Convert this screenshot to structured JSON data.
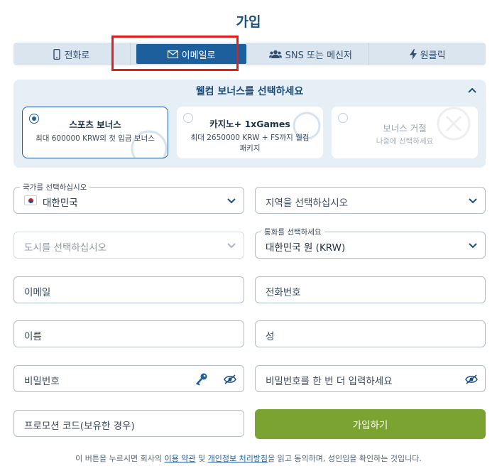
{
  "page": {
    "title": "가입"
  },
  "tabs": [
    {
      "label": "전화로",
      "icon": "phone-icon",
      "active": false
    },
    {
      "label": "이메일로",
      "icon": "mail-icon",
      "active": true
    },
    {
      "label": "SNS 또는 메신저",
      "icon": "users-icon",
      "active": false
    },
    {
      "label": "원클릭",
      "icon": "lightning-icon",
      "active": false
    }
  ],
  "bonus": {
    "heading": "웰컴 보너스를 선택하세요",
    "options": [
      {
        "title": "스포츠 보너스",
        "desc": "최대 600000 KRW의 첫 입금 보너스",
        "selected": true
      },
      {
        "title": "카지노+ 1xGames",
        "desc": "최대 2650000 KRW + FS까지 웰컴 패키지",
        "selected": false
      },
      {
        "title": "보너스 거절",
        "desc": "나중에 선택하세요",
        "selected": false
      }
    ]
  },
  "form": {
    "country": {
      "label": "국가를 선택하십시오",
      "value": "대한민국"
    },
    "region": {
      "placeholder": "지역을 선택하십시오"
    },
    "city": {
      "placeholder": "도시를 선택하십시오"
    },
    "currency": {
      "label": "통화를 선택하세요",
      "value": "대한민국 원 (KRW)"
    },
    "email": {
      "placeholder": "이메일"
    },
    "phone": {
      "placeholder": "전화번호"
    },
    "first_name": {
      "placeholder": "이름"
    },
    "last_name": {
      "placeholder": "성"
    },
    "password": {
      "placeholder": "비밀번호"
    },
    "password_repeat": {
      "placeholder": "비밀번호를 한 번 더 입력하세요"
    },
    "promo": {
      "placeholder": "프로모션 코드(보유한 경우)"
    },
    "submit_label": "가입하기"
  },
  "footer": {
    "text_before": "이 버튼을 누르시면 회사의 ",
    "terms_link": "이용 약관",
    "text_middle": " 및 ",
    "privacy_link": "개인정보 처리방침",
    "text_after": "을 읽고 동의하며, 성인임을 확인하는 것입니다."
  },
  "colors": {
    "brand_blue": "#1c5f9c",
    "title_blue": "#1c4f80",
    "register_green": "#7aa332",
    "highlight_red": "#e01e1e"
  }
}
